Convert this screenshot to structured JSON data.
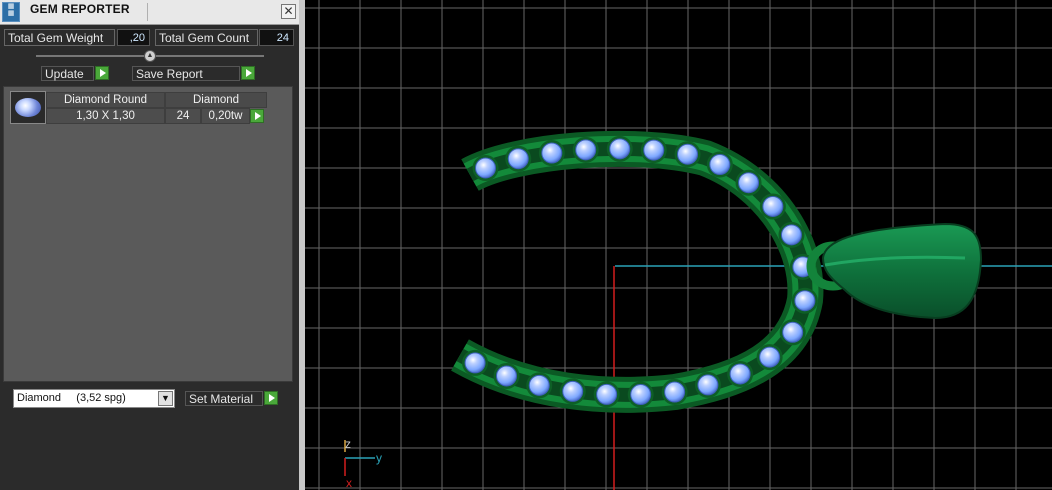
{
  "window": {
    "title": "GEM REPORTER",
    "close_glyph": "✕",
    "icon": "gem-reporter-app-icon"
  },
  "summary": {
    "total_weight_label": "Total Gem Weight",
    "total_weight_value": ",20",
    "total_count_label": "Total Gem Count",
    "total_count_value": "24"
  },
  "actions": {
    "update_label": "Update",
    "save_report_label": "Save Report"
  },
  "gem_table": {
    "headers": [
      "Diamond Round",
      "Diamond"
    ],
    "rows": [
      {
        "size": "1,30 X 1,30",
        "count": "24",
        "weight": "0,20tw"
      }
    ]
  },
  "material": {
    "selected": "Diamond     (3,52 spg)",
    "set_label": "Set Material"
  },
  "viewport": {
    "axis_labels": {
      "z": "z",
      "y": "y",
      "x": "x"
    },
    "colors": {
      "metal": "#0f6b2a",
      "stone": "#7ea8ff",
      "grid": "#8a8a8a",
      "axis_x": "#d21e1e",
      "axis_y": "#2aa3b8"
    }
  }
}
